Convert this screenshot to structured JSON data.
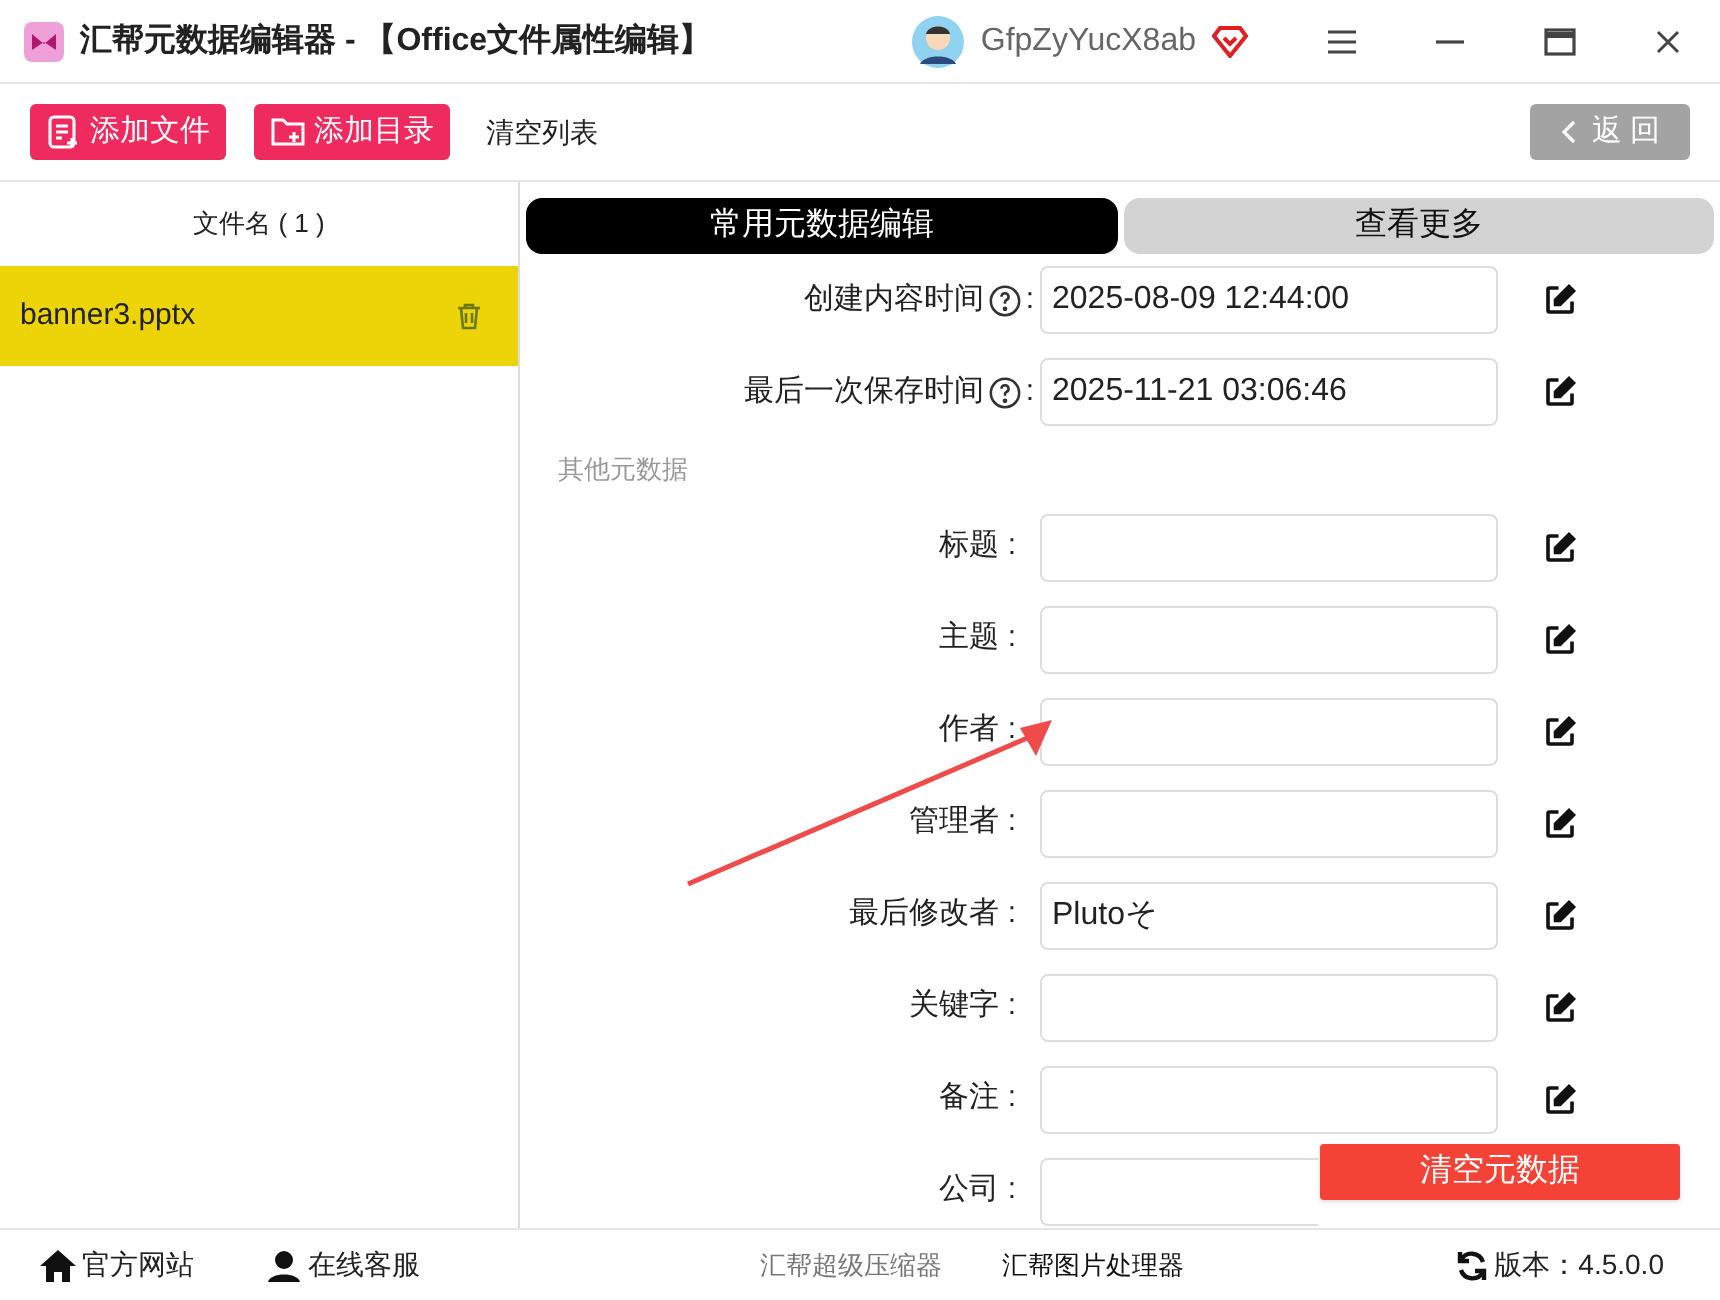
{
  "window": {
    "title": "汇帮元数据编辑器 - 【Office文件属性编辑】",
    "user": "GfpZyYucX8ab"
  },
  "toolbar": {
    "buttons": [
      {
        "label": "添加文件",
        "kind": "file"
      },
      {
        "label": "添加目录",
        "kind": "folder"
      }
    ],
    "clear_list": "清空列表",
    "back": "返 回"
  },
  "file_list": {
    "header": "文件名 ( 1 )",
    "items": [
      {
        "name": "banner3.pptx",
        "selected": true
      }
    ]
  },
  "tabs": [
    {
      "label": "常用元数据编辑",
      "selected": true
    },
    {
      "label": "查看更多",
      "selected": false
    }
  ],
  "time_fields": [
    {
      "label": "创建内容时间",
      "colon": ":",
      "value": "2025-08-09 12:44:00"
    },
    {
      "label": "最后一次保存时间",
      "colon": ":",
      "value": "2025-11-21 03:06:46"
    }
  ],
  "other_section": "其他元数据",
  "fields": [
    {
      "label": "标题 :"
    },
    {
      "label": "主题 :"
    },
    {
      "label": "作者 :"
    },
    {
      "label": "管理者 :"
    },
    {
      "label": "最后修改者 :",
      "value": "Plutoそ"
    },
    {
      "label": "关键字 :"
    },
    {
      "label": "备注 :"
    },
    {
      "label": "公司 :"
    }
  ],
  "clear_metadata": "清空元数据",
  "status_bar": {
    "links": [
      {
        "label": "官方网站",
        "kind": "home"
      },
      {
        "label": "在线客服",
        "kind": "support"
      }
    ],
    "products": [
      {
        "label": "汇帮超级压缩器",
        "selected": false
      },
      {
        "label": "汇帮图片处理器",
        "selected": true
      }
    ],
    "version": "版本：4.5.0.0"
  }
}
